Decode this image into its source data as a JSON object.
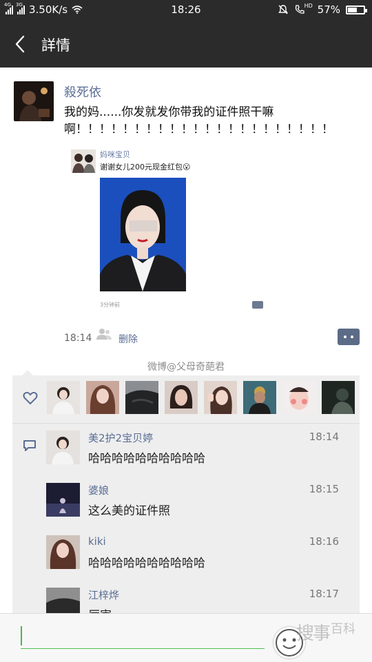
{
  "status_bar": {
    "signal1_tag": "4G",
    "signal2_tag": "3G",
    "network_speed": "3.50K/s",
    "time": "18:26",
    "hd_label": "HD",
    "battery_percent": "57%",
    "battery_level": 0.57
  },
  "nav": {
    "title": "詳情",
    "back_icon": "chevron-left-icon"
  },
  "post": {
    "author": "殺死依",
    "text": "我的妈......你发就发你带我的证件照干嘛啊！！！！！！！！！！！！！！！！！！！！！！",
    "embedded": {
      "name": "妈咪宝贝",
      "text": "谢谢女儿200元现金红包😮",
      "time": "3分钟前"
    },
    "time": "18:14",
    "delete_label": "删除"
  },
  "watermark_text": "微博@父母奇葩君",
  "likes": {
    "icon": "heart-icon",
    "count_shown": 8
  },
  "comments": [
    {
      "name": "美2护2宝贝婷",
      "time": "18:14",
      "text": "哈哈哈哈哈哈哈哈哈哈"
    },
    {
      "name": "婆娘",
      "time": "18:15",
      "text": "这么美的证件照"
    },
    {
      "name": "kiki",
      "time": "18:16",
      "text": "哈哈哈哈哈哈哈哈哈哈"
    },
    {
      "name": "江梓烨",
      "time": "18:17",
      "text": "厉害"
    }
  ],
  "watermark_badge": {
    "main": "搜事",
    "sub": "百科"
  },
  "colors": {
    "bar": "#2b2b2b",
    "link": "#5a6d94",
    "accent_green": "#4cbf52",
    "panel": "#eeeeee"
  }
}
